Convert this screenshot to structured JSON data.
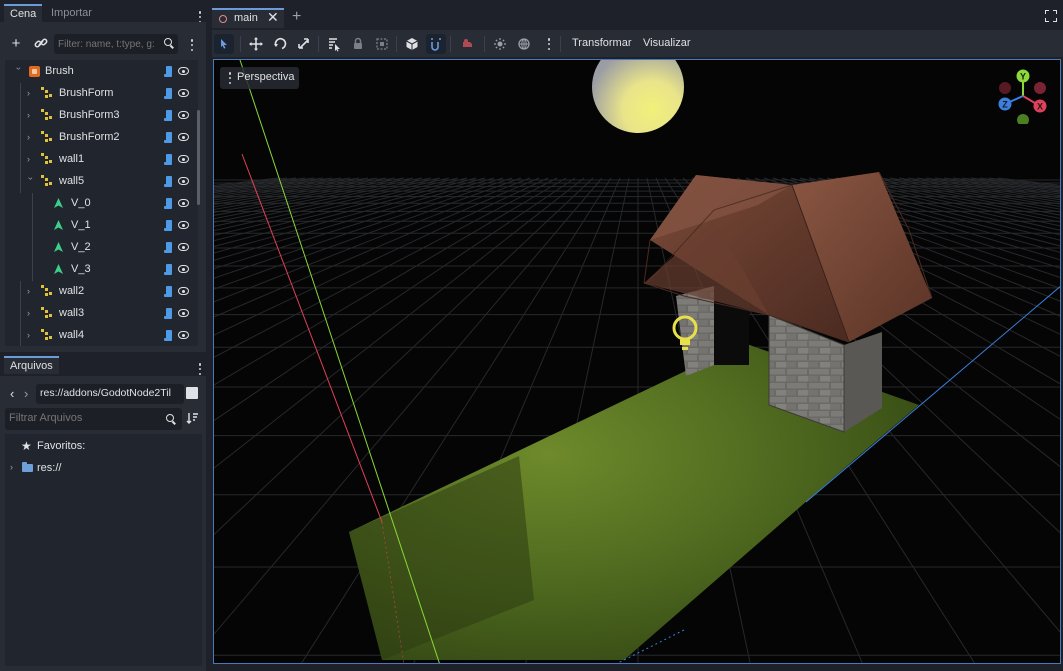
{
  "left_dock": {
    "top_tabs": [
      "Cena",
      "Importar"
    ],
    "scene_filter_placeholder": "Filter: name, t:type, g:",
    "tree": [
      {
        "label": "Brush",
        "icon": "brush-icon",
        "level": 0,
        "arrow": "expanded"
      },
      {
        "label": "BrushForm",
        "icon": "brushform-icon",
        "level": 1,
        "arrow": "collapsed"
      },
      {
        "label": "BrushForm3",
        "icon": "brushform-icon",
        "level": 1,
        "arrow": "collapsed"
      },
      {
        "label": "BrushForm2",
        "icon": "brushform-icon",
        "level": 1,
        "arrow": "collapsed"
      },
      {
        "label": "wall1",
        "icon": "brushform-icon",
        "level": 1,
        "arrow": "collapsed"
      },
      {
        "label": "wall5",
        "icon": "brushform-icon",
        "level": 1,
        "arrow": "expanded"
      },
      {
        "label": "V_0",
        "icon": "vertex-icon",
        "level": 2,
        "arrow": "none"
      },
      {
        "label": "V_1",
        "icon": "vertex-icon",
        "level": 2,
        "arrow": "none"
      },
      {
        "label": "V_2",
        "icon": "vertex-icon",
        "level": 2,
        "arrow": "none"
      },
      {
        "label": "V_3",
        "icon": "vertex-icon",
        "level": 2,
        "arrow": "none"
      },
      {
        "label": "wall2",
        "icon": "brushform-icon",
        "level": 1,
        "arrow": "collapsed"
      },
      {
        "label": "wall3",
        "icon": "brushform-icon",
        "level": 1,
        "arrow": "collapsed"
      },
      {
        "label": "wall4",
        "icon": "brushform-icon",
        "level": 1,
        "arrow": "collapsed"
      }
    ],
    "bottom_tabs": [
      "Arquivos"
    ],
    "path_value": "res://addons/GodotNode2Til",
    "files_filter_placeholder": "Filtrar Arquivos",
    "favorites_label": "Favoritos:",
    "res_label": "res://"
  },
  "main": {
    "tab_name": "main",
    "menus": {
      "transform": "Transformar",
      "view": "Visualizar"
    },
    "viewport_label": "Perspectiva",
    "gizmo_axes": {
      "y": "Y",
      "x": "X",
      "z": "Z"
    },
    "colors": {
      "accent": "#6d9ad9",
      "axis_x": "#e0405a",
      "axis_y": "#8ad83a",
      "axis_z": "#3b7fe0"
    }
  }
}
